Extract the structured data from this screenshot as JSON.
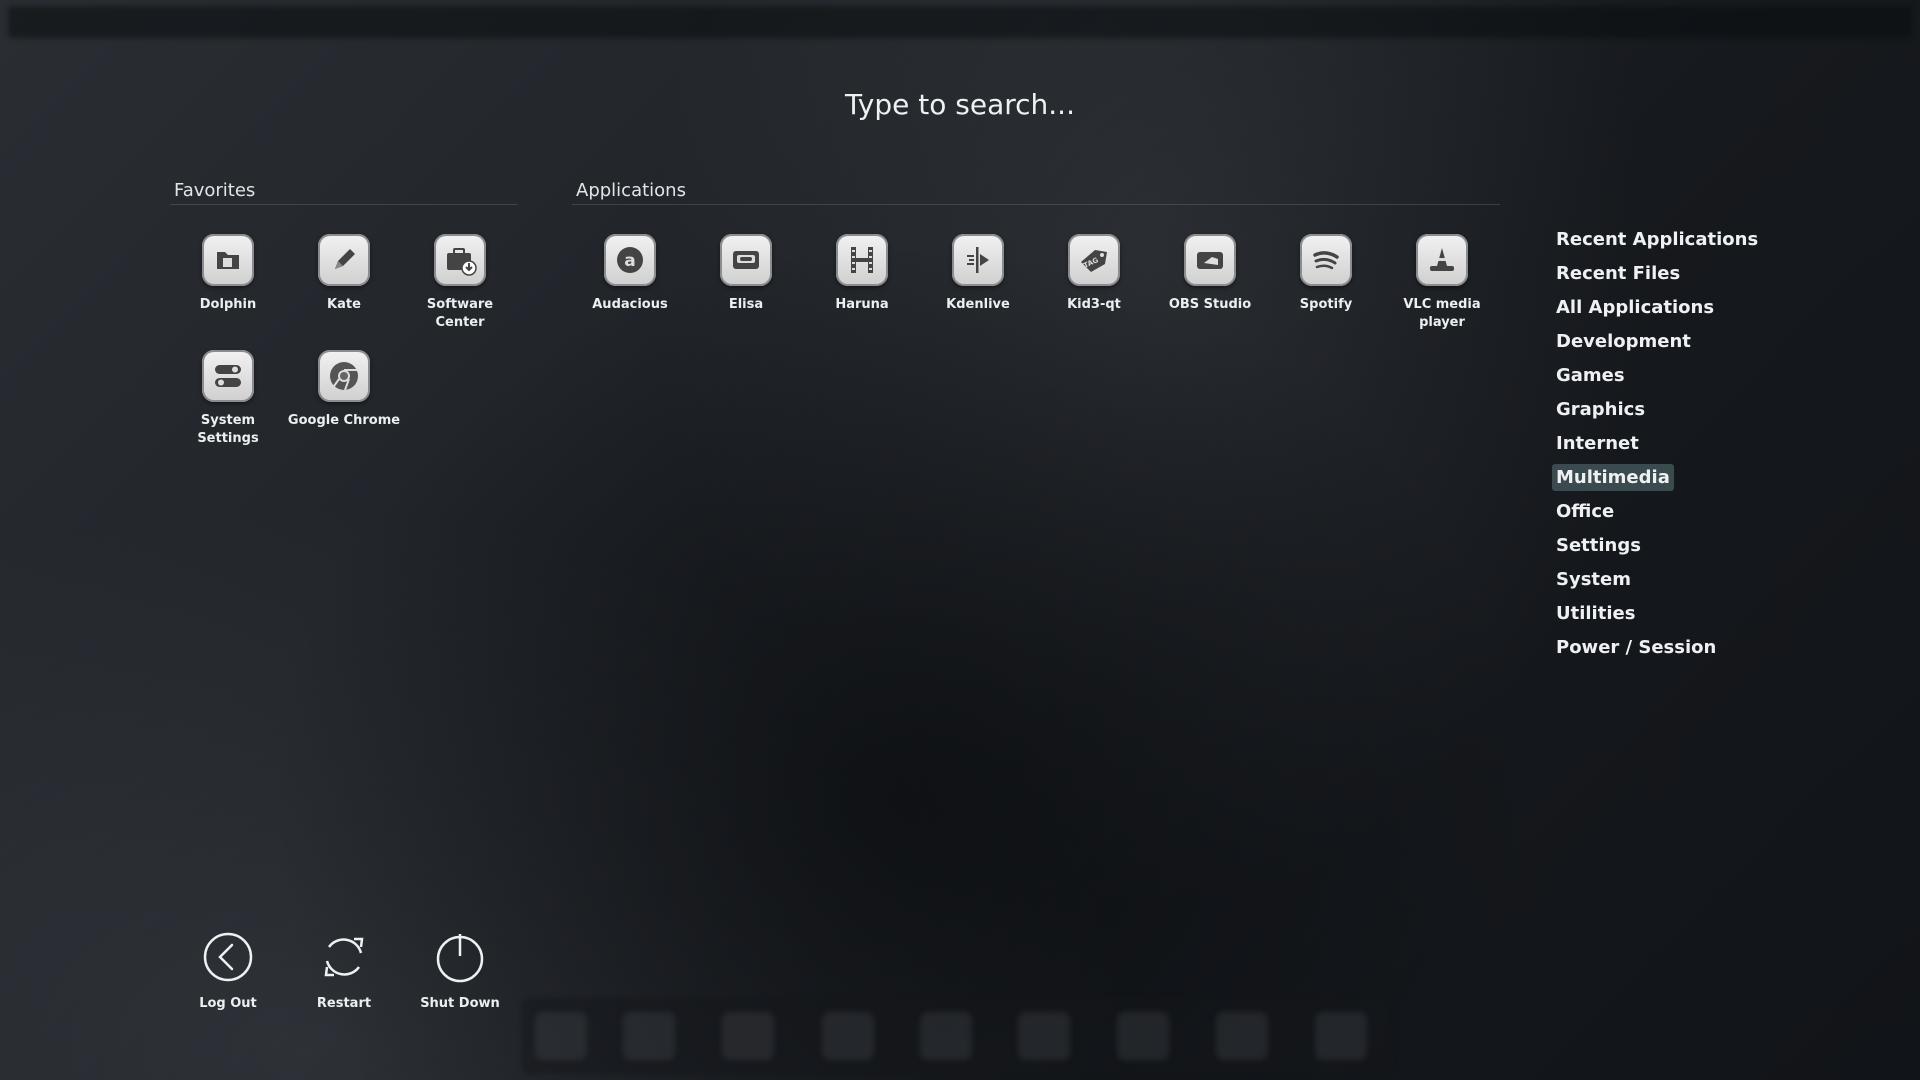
{
  "search": {
    "placeholder": "Type to search..."
  },
  "favorites": {
    "title": "Favorites",
    "items": [
      {
        "label": "Dolphin",
        "icon": "folder-icon"
      },
      {
        "label": "Kate",
        "icon": "pen-icon"
      },
      {
        "label": "Software Center",
        "icon": "software-center-icon"
      },
      {
        "label": "System Settings",
        "icon": "settings-toggle-icon"
      },
      {
        "label": "Google Chrome",
        "icon": "chrome-icon"
      }
    ]
  },
  "applications": {
    "title": "Applications",
    "items": [
      {
        "label": "Audacious",
        "icon": "audacious-icon"
      },
      {
        "label": "Elisa",
        "icon": "cassette-icon"
      },
      {
        "label": "Haruna",
        "icon": "film-icon"
      },
      {
        "label": "Kdenlive",
        "icon": "kdenlive-icon"
      },
      {
        "label": "Kid3-qt",
        "icon": "tag-icon"
      },
      {
        "label": "OBS Studio",
        "icon": "camera-icon"
      },
      {
        "label": "Spotify",
        "icon": "spotify-icon"
      },
      {
        "label": "VLC media player",
        "icon": "cone-icon"
      }
    ]
  },
  "categories": {
    "active": "Multimedia",
    "items": [
      "Recent Applications",
      "Recent Files",
      "All Applications",
      "Development",
      "Games",
      "Graphics",
      "Internet",
      "Multimedia",
      "Office",
      "Settings",
      "System",
      "Utilities",
      "Power / Session"
    ]
  },
  "power": {
    "items": [
      {
        "label": "Log Out",
        "icon": "log-out-icon"
      },
      {
        "label": "Restart",
        "icon": "restart-icon"
      },
      {
        "label": "Shut Down",
        "icon": "power-icon"
      }
    ]
  },
  "colors": {
    "active_category_bg": "#3a4a4f",
    "text": "#eef0f2",
    "icon_bg": "#e0e0e0",
    "icon_glyph": "#444444"
  }
}
